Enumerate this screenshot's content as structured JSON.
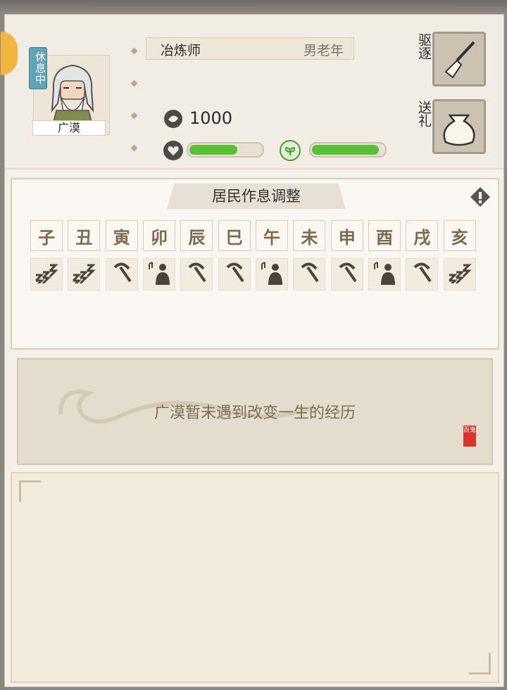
{
  "resident": {
    "name": "广漠",
    "status": "休息中",
    "job": "冶炼师",
    "age_gender": "男老年",
    "coins": "1000",
    "health_level": 0.64,
    "mood_level": 0.9
  },
  "actions": {
    "expel_label": "驱逐",
    "gift_label": "送礼"
  },
  "schedule": {
    "title": "居民作息调整",
    "hours": [
      "子",
      "丑",
      "寅",
      "卯",
      "辰",
      "巳",
      "午",
      "未",
      "申",
      "酉",
      "戌",
      "亥"
    ],
    "activities": [
      "sleep-icon",
      "sleep-icon",
      "pickaxe-icon",
      "music-rest-icon",
      "pickaxe-icon",
      "pickaxe-icon",
      "music-rest-icon",
      "pickaxe-icon",
      "pickaxe-icon",
      "music-rest-icon",
      "pickaxe-icon",
      "sleep-icon"
    ]
  },
  "story": {
    "text": "广漠暂未遇到改变一生的经历",
    "stamp": "百鬼"
  },
  "colors": {
    "bar_fill": "#5ac033",
    "badge": "#5fa3b6"
  }
}
